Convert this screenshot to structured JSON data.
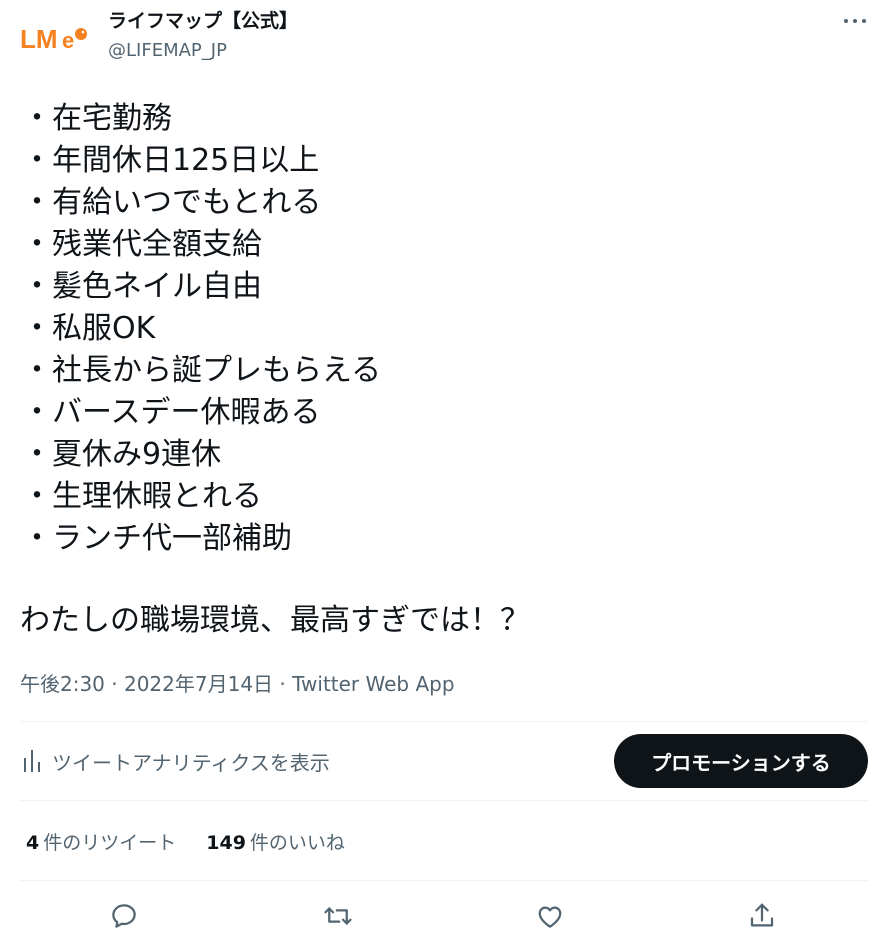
{
  "account": {
    "display_name": "ライフマップ【公式】",
    "handle": "@LIFEMAP_JP",
    "logo_text": "LMe"
  },
  "tweet": {
    "lines": [
      "・在宅勤務",
      "・年間休日125日以上",
      "・有給いつでもとれる",
      "・残業代全額支給",
      "・髪色ネイル自由",
      "・私服OK",
      "・社長から誕プレもらえる",
      "・バースデー休暇ある",
      "・夏休み9連休",
      "・生理休暇とれる",
      "・ランチ代一部補助"
    ],
    "closing": "わたしの職場環境、最高すぎでは！？",
    "meta": "午後2:30 · 2022年7月14日 · Twitter Web App"
  },
  "analytics": {
    "label": "ツイートアナリティクスを表示"
  },
  "promote": {
    "label": "プロモーションする"
  },
  "stats": {
    "retweets": {
      "count": "4",
      "label": "件のリツイート"
    },
    "likes": {
      "count": "149",
      "label": "件のいいね"
    }
  },
  "icons": {
    "more": "more-icon",
    "analytics": "analytics-icon",
    "reply": "reply-icon",
    "retweet": "retweet-icon",
    "like": "like-icon",
    "share": "share-icon"
  },
  "colors": {
    "text": "#0f1419",
    "secondary": "#536471",
    "logo_orange": "#f58220",
    "button": "#0f1419"
  }
}
